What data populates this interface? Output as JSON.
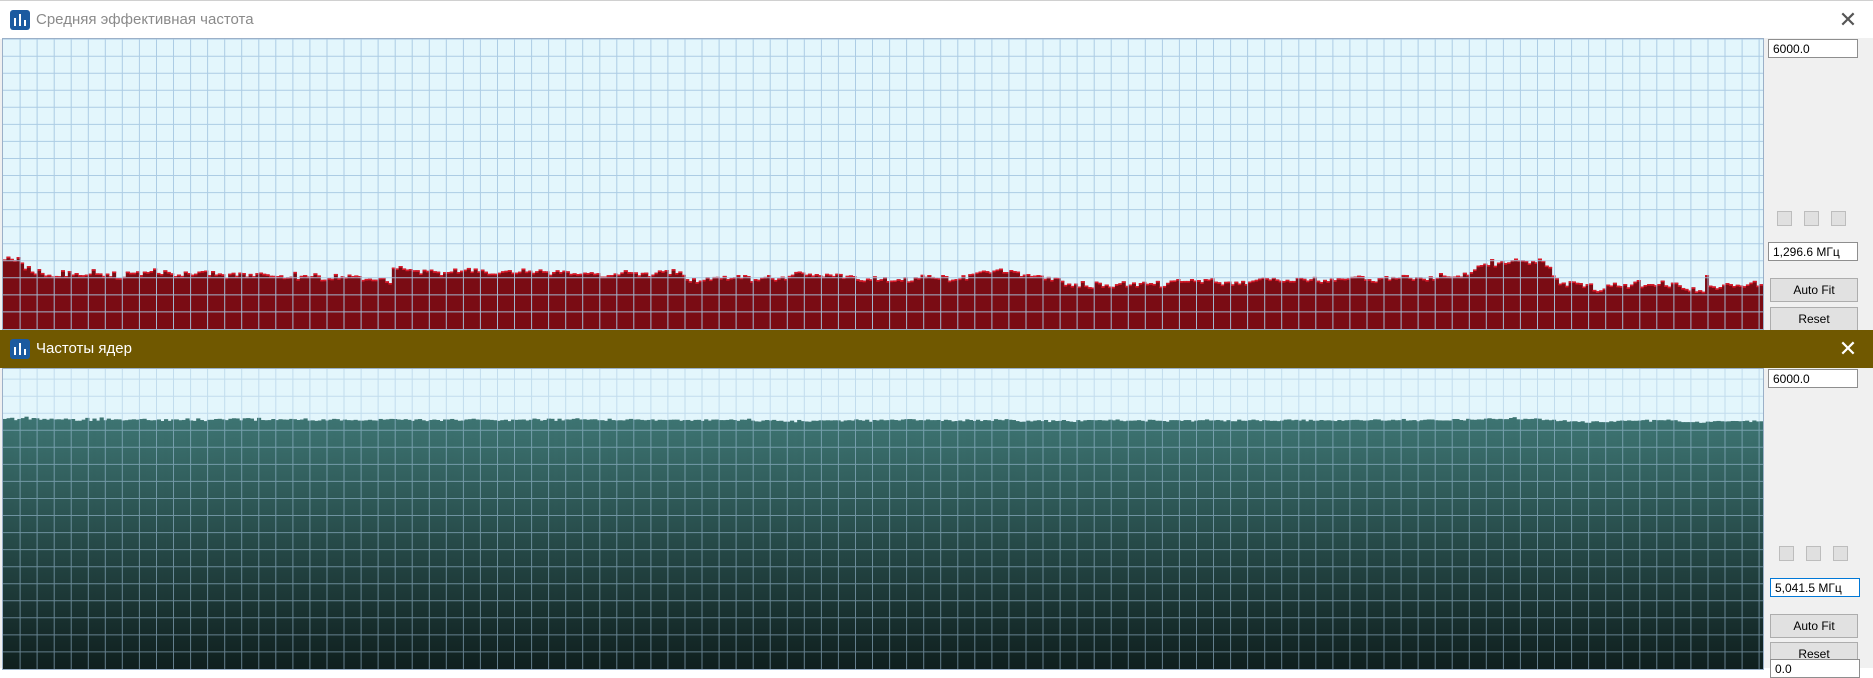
{
  "window_avg": {
    "title": "Средняя эффективная частота",
    "max_value": "6000.0",
    "current_value": "1,296.6 МГц",
    "auto_fit_label": "Auto Fit",
    "reset_label": "Reset",
    "bar_color": "#7a0c14",
    "bar_edge_color": "#dd1a2a",
    "graph_bg": "#e3f6fc",
    "grid_color": "#a7c8e2",
    "scale_max_mhz": 6000,
    "samples_mhz": [
      1460,
      1519,
      1472,
      1443,
      1508,
      1396,
      1263,
      1320,
      1203,
      1162,
      1256,
      1176,
      1121,
      1137,
      1103,
      1113,
      1107,
      1233,
      1111,
      1217,
      1141,
      1174,
      1132,
      1127,
      1140,
      1160,
      1254,
      1167,
      1166,
      1114,
      1163,
      1106,
      1207,
      1068,
      1065,
      1094,
      1204,
      1179,
      1180,
      1210,
      1130,
      1204,
      1192,
      1217,
      1271,
      1176,
      1154,
      1232,
      1197,
      1168,
      1112,
      1142,
      1114,
      1207,
      1175,
      1139,
      1160,
      1206,
      1216,
      1227,
      1129,
      1216,
      1142,
      1166,
      1148,
      1077,
      1160,
      1179,
      1116,
      1183,
      1175,
      1101,
      1156,
      1107,
      1171,
      1185,
      1159,
      1147,
      1117,
      1115,
      1111,
      1126,
      1077,
      1086,
      1097,
      1198,
      1046,
      1115,
      1132,
      1100,
      1107,
      1168,
      1124,
      1032,
      1035,
      1066,
      1054,
      1155,
      1065,
      1106,
      1085,
      1141,
      1111,
      1124,
      1110,
      1030,
      1051,
      1055,
      1035,
      1035,
      1072,
      1076,
      1002,
      965,
      1288,
      1271,
      1322,
      1271,
      1246,
      1259,
      1232,
      1233,
      1166,
      1243,
      1221,
      1248,
      1212,
      1203,
      1132,
      1196,
      1195,
      1204,
      1268,
      1196,
      1223,
      1244,
      1281,
      1207,
      1270,
      1209,
      1246,
      1202,
      1158,
      1162,
      1159,
      1180,
      1211,
      1221,
      1234,
      1183,
      1181,
      1202,
      1269,
      1205,
      1224,
      1178,
      1211,
      1250,
      1211,
      1209,
      1137,
      1195,
      1232,
      1194,
      1224,
      1211,
      1157,
      1169,
      1153,
      1159,
      1182,
      1172,
      1191,
      1161,
      1171,
      1100,
      1101,
      1129,
      1133,
      1166,
      1144,
      1187,
      1233,
      1193,
      1190,
      1189,
      1125,
      1178,
      1183,
      1112,
      1140,
      1181,
      1229,
      1210,
      1238,
      1153,
      1255,
      1174,
      1208,
      1136,
      1047,
      1003,
      1068,
      982,
      1015,
      1031,
      1087,
      1039,
      1092,
      1094,
      1069,
      1114,
      1047,
      1072,
      1086,
      1132,
      1077,
      1133,
      1108,
      1003,
      1047,
      1033,
      1082,
      1093,
      1131,
      1068,
      1029,
      1063,
      1101,
      1051,
      1114,
      1138,
      1197,
      1207,
      1186,
      1137,
      1160,
      1123,
      1152,
      1129,
      1099,
      1158,
      1144,
      1113,
      1160,
      1155,
      1081,
      1116,
      1126,
      1110,
      1045,
      1023,
      1014,
      1059,
      1042,
      1106,
      1026,
      1044,
      1089,
      1006,
      1016,
      1019,
      1045,
      1026,
      1087,
      999,
      1014,
      1089,
      1066,
      1137,
      1094,
      1133,
      1092,
      1079,
      1064,
      1131,
      1110,
      1014,
      1035,
      1049,
      1059,
      1127,
      1049,
      1149,
      1159,
      1186,
      1206,
      1225,
      1213,
      1187,
      1224,
      1247,
      1266,
      1196,
      1196,
      1238,
      1215,
      1205,
      1111,
      1140,
      1154,
      1113,
      1122,
      1133,
      1119,
      1053,
      1093,
      1029,
      1083,
      1079,
      1011,
      925,
      954,
      904,
      951,
      891,
      1004,
      912,
      878,
      871,
      995,
      969,
      897,
      934,
      891,
      884,
      940,
      959,
      1001,
      905,
      933,
      977,
      902,
      965,
      990,
      948,
      963,
      945,
      1009,
      890,
      903,
      968,
      1016,
      1019,
      1049,
      1005,
      1008,
      1008,
      1049,
      1016,
      1026,
      980,
      1048,
      1038,
      1064,
      993,
      980,
      934,
      990,
      994,
      937,
      993,
      954,
      1009,
      943,
      996,
      1015,
      1032,
      1056,
      1083,
      1067,
      1039,
      1082,
      1040,
      1012,
      1007,
      1032,
      1008,
      1008,
      1079,
      1078,
      1053,
      1015,
      1043,
      1093,
      1013,
      985,
      1031,
      1003,
      1056,
      1023,
      1066,
      1059,
      1053,
      1063,
      1093,
      1099,
      1119,
      1112,
      1042,
      1045,
      1006,
      996,
      1069,
      1080,
      1111,
      1039,
      1092,
      1070,
      1083,
      1134,
      1130,
      1081,
      1041,
      1087,
      1085,
      1053,
      1028,
      1105,
      1046,
      1080,
      1175,
      1122,
      1103,
      1097,
      1102,
      1120,
      1099,
      1180,
      1137,
      1192,
      1250,
      1329,
      1341,
      1371,
      1342,
      1465,
      1326,
      1395,
      1424,
      1382,
      1398,
      1447,
      1478,
      1445,
      1446,
      1431,
      1376,
      1436,
      1399,
      1479,
      1433,
      1332,
      1303,
      1124,
      1066,
      950,
      975,
      906,
      1002,
      998,
      969,
      963,
      892,
      940,
      956,
      820,
      793,
      811,
      850,
      931,
      913,
      970,
      908,
      900,
      944,
      874,
      931,
      992,
      1028,
      888,
      923,
      942,
      941,
      917,
      944,
      1015,
      916,
      887,
      972,
      972,
      917,
      861,
      841,
      807,
      875,
      789,
      813,
      782,
      1132,
      911,
      895,
      853,
      880,
      931,
      963,
      941,
      902,
      928,
      914,
      898,
      935,
      973,
      1010,
      910,
      940
    ]
  },
  "window_cores": {
    "title": "Частоты ядер",
    "max_value": "6000.0",
    "current_value": "5,041.5 МГц",
    "min_value": "0.0",
    "auto_fit_label": "Auto Fit",
    "reset_label": "Reset",
    "titlebar_color": "#705800",
    "bar_color_top": "#3d7472",
    "bar_color_bottom": "#0f1f1e",
    "graph_bg": "#e3f6fc",
    "grid_color": "#a7c8e2",
    "scale_max_mhz": 6000,
    "samples_mhz": [
      5072,
      5087,
      5096,
      5047,
      5072,
      5089,
      5118,
      5060,
      5091,
      5085,
      5055,
      5074,
      5057,
      5078,
      5062,
      5066,
      5060,
      5080,
      5063,
      5071,
      5035,
      5036,
      5058,
      5094,
      5031,
      5080,
      5039,
      5102,
      5046,
      5079,
      5054,
      5065,
      5063,
      5041,
      5047,
      5058,
      5065,
      5057,
      5070,
      5076,
      5049,
      5043,
      5047,
      5061,
      5030,
      5068,
      5034,
      5063,
      5063,
      5046,
      5052,
      5083,
      5042,
      5033,
      5083,
      5050,
      5028,
      5054,
      5055,
      5071,
      5075,
      5063,
      5048,
      5076,
      5086,
      5082,
      5044,
      5085,
      5090,
      5080,
      5036,
      5095,
      5050,
      5046,
      5049,
      5071,
      5049,
      5067,
      5060,
      5057,
      5073,
      5067,
      5051,
      5060,
      5083,
      5039,
      5044,
      5033,
      5041,
      5065,
      5041,
      5057,
      5074,
      5068,
      5040,
      5059,
      5048,
      5044,
      5054,
      5039,
      5038,
      5044,
      5055,
      5043,
      5040,
      5072,
      5057,
      5064,
      5073,
      5071,
      5061,
      5054,
      5068,
      5054,
      5033,
      5062,
      5070,
      5045,
      5028,
      5051,
      5060,
      5051,
      5031,
      5062,
      5060,
      5072,
      5055,
      5036,
      5040,
      5061,
      5067,
      5077,
      5061,
      5056,
      5061,
      5058,
      5053,
      5046,
      5034,
      5047,
      5056,
      5028,
      5059,
      5053,
      5058,
      5061,
      5041,
      5055,
      5080,
      5068,
      5038,
      5051,
      5079,
      5075,
      5033,
      5077,
      5042,
      5063,
      5059,
      5074,
      5086,
      5061,
      5066,
      5055,
      5064,
      5066,
      5046,
      5047,
      5034,
      5077,
      5049,
      5042,
      5046,
      5042,
      5062,
      5073,
      5059,
      5063,
      5053,
      5045,
      5052,
      5063,
      5037,
      5055,
      5053,
      5049,
      5055,
      5058,
      5058,
      5035,
      5049,
      5052,
      5034,
      5053,
      5054,
      5033,
      5064,
      5039,
      5059,
      5060,
      5049,
      5048,
      5052,
      5062,
      5050,
      5034,
      5058,
      5055,
      5077,
      5039,
      5023,
      5018,
      5040,
      5050,
      5041,
      5053,
      5032,
      5036,
      5016,
      5017,
      5038,
      5005,
      5052,
      5028,
      5021,
      5016,
      5037,
      5034,
      5045,
      5041,
      5045,
      5042,
      5045,
      5044,
      5020,
      5041,
      5047,
      5039,
      5064,
      5048,
      5037,
      5057,
      5015,
      5051,
      5042,
      5059,
      5045,
      5048,
      5059,
      5050,
      5041,
      5060,
      5068,
      5070,
      5066,
      5041,
      5049,
      5043,
      5061,
      5048,
      5048,
      5051,
      5030,
      5056,
      5048,
      5023,
      5030,
      5042,
      5025,
      5064,
      5051,
      5032,
      5056,
      5029,
      5050,
      5045,
      5032,
      5068,
      5055,
      5045,
      5068,
      5056,
      5050,
      5029,
      5014,
      5017,
      5038,
      5022,
      5038,
      5047,
      5028,
      5050,
      5009,
      5045,
      5030,
      5034,
      5051,
      5029,
      5018,
      5010,
      5049,
      5024,
      5044,
      5051,
      5049,
      5045,
      5050,
      5043,
      5040,
      5057,
      5044,
      5061,
      5037,
      5026,
      5037,
      5037,
      5040,
      5048,
      5035,
      5020,
      5056,
      5053,
      5036,
      5036,
      5030,
      5016,
      5048,
      5048,
      5047,
      5032,
      5049,
      5049,
      5019,
      5038,
      5047,
      5047,
      5062,
      5041,
      5043,
      5051,
      5043,
      5022,
      5048,
      5026,
      5025,
      5058,
      5036,
      5034,
      5047,
      5059,
      5046,
      5028,
      5049,
      5041,
      5033,
      5035,
      5028,
      5039,
      5058,
      5063,
      5045,
      5054,
      5039,
      5059,
      5025,
      5055,
      5036,
      5038,
      5051,
      5041,
      5045,
      5039,
      5029,
      5050,
      5035,
      5046,
      5048,
      5053,
      5054,
      5046,
      5038,
      5042,
      5049,
      5064,
      5061,
      5040,
      5037,
      5043,
      5056,
      5045,
      5047,
      5072,
      5038,
      5044,
      5049,
      5026,
      5046,
      5055,
      5062,
      5061,
      5046,
      5043,
      5041,
      5042,
      5040,
      5071,
      5071,
      5051,
      5041,
      5075,
      5058,
      5055,
      5063,
      5060,
      5078,
      5086,
      5074,
      5066,
      5074,
      5067,
      5068,
      5091,
      5108,
      5065,
      5058,
      5076,
      5069,
      5073,
      5084,
      5077,
      5048,
      5057,
      5046,
      5056,
      5027,
      5034,
      5047,
      5016,
      5024,
      5026,
      5012,
      5025,
      4996,
      4994,
      5023,
      5026,
      5008,
      5007,
      5006,
      5025,
      5014,
      5034,
      5040,
      5033,
      5043,
      5034,
      5035,
      5039,
      5048,
      5057,
      5016,
      5052,
      5046,
      5047,
      5044,
      5059,
      5042,
      5047,
      5022,
      5008,
      5008,
      5008,
      5007,
      5017,
      4992,
      4996,
      5018,
      5013,
      5027,
      5032,
      5025,
      5021,
      5024,
      5031,
      5030,
      5025,
      5030,
      5038,
      5009,
      5041,
      5022,
      5025
    ]
  }
}
